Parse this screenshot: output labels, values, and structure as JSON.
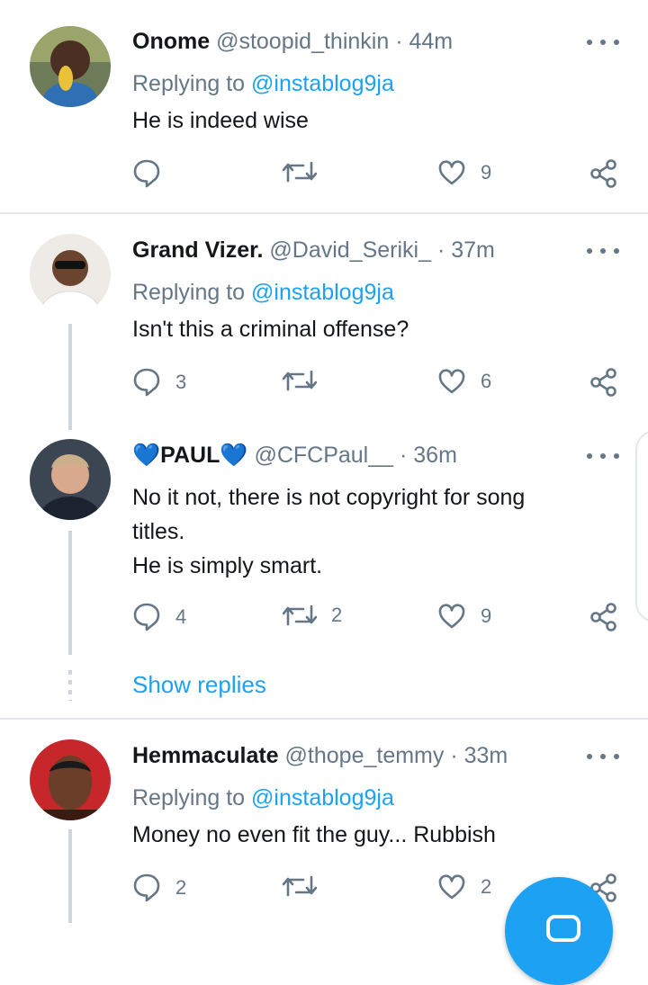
{
  "tweets": [
    {
      "name": "Onome",
      "handle": "@stoopid_thinkin",
      "time": "44m",
      "replying_label": "Replying to",
      "replying_to": "@instablog9ja",
      "text": [
        "He is indeed wise"
      ],
      "replies": "",
      "retweets": "",
      "likes": "9"
    },
    {
      "name": "Grand Vizer.",
      "handle": "@David_Seriki_",
      "time": "37m",
      "replying_label": "Replying to",
      "replying_to": "@instablog9ja",
      "text": [
        "Isn't this a criminal offense?"
      ],
      "replies": "3",
      "retweets": "",
      "likes": "6"
    },
    {
      "name": "PAUL",
      "name_emoji": "💙",
      "handle": "@CFCPaul__",
      "time": "36m",
      "text": [
        "No it not, there is not copyright for song",
        "titles.",
        "He is simply smart."
      ],
      "replies": "4",
      "retweets": "2",
      "likes": "9"
    },
    {
      "name": "Hemmaculate",
      "handle": "@thope_temmy",
      "time": "33m",
      "replying_label": "Replying to",
      "replying_to": "@instablog9ja",
      "text": [
        "Money no even fit the guy... Rubbish"
      ],
      "replies": "2",
      "retweets": "",
      "likes": "2"
    }
  ],
  "show_replies": "Show replies",
  "separator": "·",
  "icons": [
    "reply-icon",
    "retweet-icon",
    "like-icon",
    "share-icon",
    "more-icon",
    "compose-icon"
  ],
  "colors": {
    "accent": "#1da1f2",
    "muted": "#657786",
    "divider": "#e1e8ed"
  }
}
